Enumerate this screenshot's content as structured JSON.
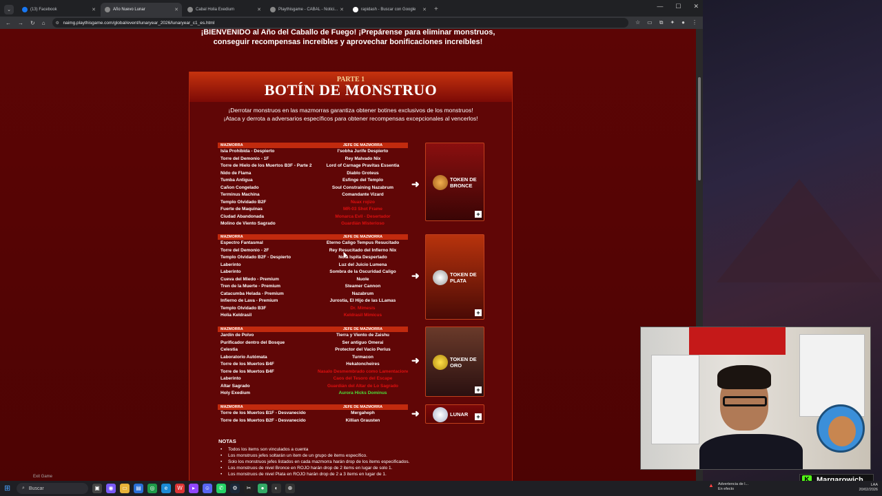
{
  "browser": {
    "tabs": [
      {
        "label": "(13) Facebook",
        "color": "#1877f2"
      },
      {
        "label": "Año Nuevo Lunar",
        "color": "#888888",
        "active": true
      },
      {
        "label": "Cabal Holia Exedium",
        "color": "#888888"
      },
      {
        "label": "Playthisgame - CABAL - Notici...",
        "color": "#888888"
      },
      {
        "label": "rapidash - Buscar con Google",
        "color": "#ffffff"
      }
    ],
    "url": "naimg.playthisgame.com/global/event/lunaryear_2026/lunaryear_c1_es.html"
  },
  "page": {
    "welcome_line1": "¡BIENVENIDO al Año del Caballo de Fuego! ¡Prepárense para eliminar monstruos,",
    "welcome_line2": "conseguir recompensas increíbles y aprovechar bonificaciones increíbles!",
    "parte": "PARTE 1",
    "title": "BOTÍN DE MONSTRUO",
    "intro1": "¡Derrotar monstruos en las mazmorras garantiza obtener botines exclusivos de los monstruos!",
    "intro2": "¡Ataca y derrota a adversarios específicos para obtener recompensas excepcionales al vencerlos!",
    "col_dungeon": "MAZMORRA",
    "col_boss": "JEFE DE MAZMORRA",
    "tables": [
      {
        "token": "TOKEN DE BRONCE",
        "rows": [
          [
            "Isla Prohibida - Despierto",
            "I'sobha Jurife Despierto",
            ""
          ],
          [
            "Torre del Demonio - 1F",
            "Rey Malvado Nix",
            ""
          ],
          [
            "Torre de Hielo de los Muertos B3F - Parte 2",
            "Lord of Carnage Pravitas Essentia",
            ""
          ],
          [
            "Nido de Flama",
            "Diablo Groteus",
            ""
          ],
          [
            "Tumba Antigua",
            "Esfinge del Templo",
            ""
          ],
          [
            "Cañon Congelado",
            "Soul Constraining Nazabrum",
            ""
          ],
          [
            "Terminus Machina",
            "Comandante Vizard",
            ""
          ],
          [
            "Templo Olvidado B2F",
            "Nuax rojizo",
            "red"
          ],
          [
            "Fuerte de Maquinas",
            "MR-03 Shot Frame",
            "red"
          ],
          [
            "Ciudad Abandonada",
            "Monarca Evil - Desertador",
            "red"
          ],
          [
            "Molino de Viento Sagrado",
            "Guardián Misterioso",
            "red"
          ]
        ]
      },
      {
        "token": "TOKEN DE PLATA",
        "rows": [
          [
            "Espectro Fantasmal",
            "Eterno Caligo Tempus Resucitado",
            ""
          ],
          [
            "Torre del Demonio - 2F",
            "Rey Resucitado del Infierno Nix",
            ""
          ],
          [
            "Templo Olvidado B2F - Despierto",
            "Nola Ispita Despertado",
            ""
          ],
          [
            "Laberinto",
            "Luz del Juicio Lumena",
            ""
          ],
          [
            "Laberinto",
            "Sombra de la Oscuridad Caligo",
            ""
          ],
          [
            "Cueva del Miedo - Premium",
            "Nuole",
            ""
          ],
          [
            "Tren de la Muerte - Premium",
            "Steamer Cannon",
            ""
          ],
          [
            "Catacumba Helada - Premium",
            "Nazabrum",
            ""
          ],
          [
            "Infierno de Lava - Premium",
            "Jurostia, El Hijo de las LLamas",
            ""
          ],
          [
            "Templo Olvidado B3F",
            "Dr. Mimesis",
            "red"
          ],
          [
            "Holia Keldrasil",
            "Keldrasil Mimicus",
            "red"
          ]
        ]
      },
      {
        "token": "TOKEN DE ORO",
        "rows": [
          [
            "Jardín de Polvo",
            "Tierra y Viento de Zaishu",
            ""
          ],
          [
            "Purificador dentro del Bosque",
            "Ser antiguo Omerai",
            ""
          ],
          [
            "Celestia",
            "Protector del Vacio Perius",
            ""
          ],
          [
            "Laboratorio Autómata",
            "Turmacon",
            ""
          ],
          [
            "Torre de los Muertos B4F",
            "Hekatoncheires",
            ""
          ],
          [
            "Torre de los Muertos B4F",
            "Nasalo Desmembrado como Lamentaciones",
            "red"
          ],
          [
            "Laberinto",
            "Caos del Tesoro del Escape",
            "red"
          ],
          [
            "Altar Sagrado",
            "Guardián del Altar de Lo Sagrado",
            "red"
          ],
          [
            "Holy Exedium",
            "Aurora Hicks Dominus",
            "green"
          ]
        ]
      },
      {
        "token": "LUNAR",
        "rows": [
          [
            "Torre de los Muertos B1F - Desvanecido",
            "Mergaheph",
            ""
          ],
          [
            "Torre de los Muertos B2F - Desvanecido",
            "Killian Grausten",
            ""
          ]
        ]
      }
    ],
    "notes_title": "NOTAS",
    "notes": [
      "Todos los items son vinculados a cuenta",
      "Los monstruos jefes soltarán un item de un grupo de items específico.",
      "Solo los monstruos jefes listados en cada mazmorra harán drop de los items especificados.",
      "Los monstruos de nivel Bronce en ROJO harán drop de 2 items en lugar de solo 1.",
      "Los monstruos de nivel Plata en ROJO harán drop de 2 a 3 items en lugar de 1."
    ]
  },
  "overlay": {
    "channel": "Margarowich",
    "exit_game": "Exit Game"
  },
  "taskbar": {
    "search": "Buscar",
    "notification_title": "Advertencia de l...",
    "notification_sub": "En efecto",
    "lang": "LAA",
    "date": "20/02/2026"
  }
}
